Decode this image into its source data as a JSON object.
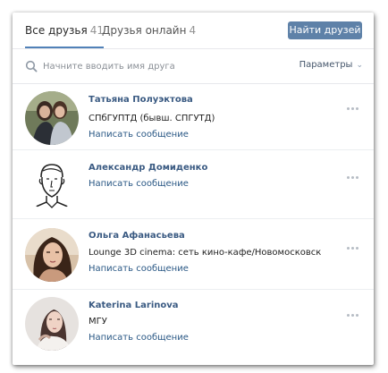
{
  "tabs": {
    "all_label": "Все друзья",
    "all_count": "41",
    "online_label": "Друзья онлайн",
    "online_count": "4"
  },
  "find_button": "Найти друзей",
  "search": {
    "placeholder": "Начните вводить имя друга",
    "params_label": "Параметры"
  },
  "friends": [
    {
      "name": "Татьяна Полуэктова",
      "sub": "СПбГУПТД (бывш. СПГУТД)",
      "action": "Написать сообщение",
      "avatar": "photo-avatar"
    },
    {
      "name": "Александр Домиденко",
      "sub": "",
      "action": "Написать сообщение",
      "avatar": "sketch-avatar"
    },
    {
      "name": "Ольга Афанасьева",
      "sub": "Lounge 3D cinema: сеть кино-кафе/Новомосковск",
      "action": "Написать сообщение",
      "avatar": "photo-avatar"
    },
    {
      "name": "Katerina Larinova",
      "sub": "МГУ",
      "action": "Написать сообщение",
      "avatar": "photo-avatar"
    }
  ],
  "colors": {
    "accent": "#5181b8",
    "button": "#5e81a8",
    "link": "#2a5885",
    "name": "#3a5a82"
  }
}
